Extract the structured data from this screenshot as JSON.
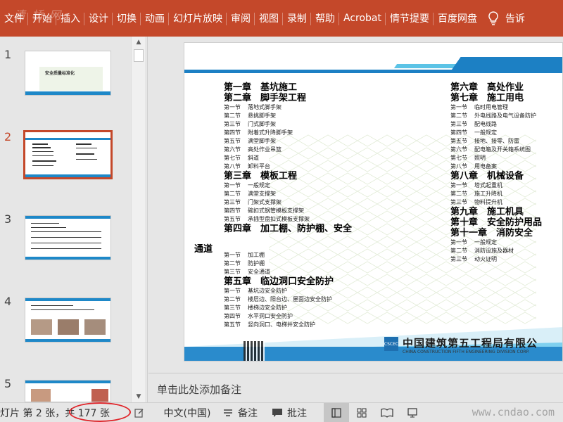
{
  "ribbon": {
    "tabs": [
      "文件",
      "开始",
      "插入",
      "设计",
      "切换",
      "动画",
      "幻灯片放映",
      "审阅",
      "视图",
      "录制",
      "帮助",
      "Acrobat",
      "情节提要",
      "百度网盘"
    ],
    "tell_me": "告诉",
    "watermark": "清 桥 网"
  },
  "thumbnails": [
    {
      "num": "1"
    },
    {
      "num": "2",
      "active": true
    },
    {
      "num": "3"
    },
    {
      "num": "4"
    },
    {
      "num": "5"
    }
  ],
  "thumb1_title": "安全质量标准化",
  "slide": {
    "left_chapters": [
      {
        "title": "第一章　基坑施工",
        "sections": []
      },
      {
        "title": "第二章　脚手架工程",
        "sections": [
          [
            "第一节",
            "落地式脚手架"
          ],
          [
            "第二节",
            "悬挑脚手架"
          ],
          [
            "第三节",
            "门式脚手架"
          ],
          [
            "第四节",
            "附着式升降脚手架"
          ],
          [
            "第五节",
            "满堂脚手架"
          ],
          [
            "第六节",
            "高处作业吊篮"
          ],
          [
            "第七节",
            "斜道"
          ],
          [
            "第八节",
            "卸料平台"
          ]
        ]
      },
      {
        "title": "第三章　模板工程",
        "sections": [
          [
            "第一节",
            "一般规定"
          ],
          [
            "第二节",
            "满堂支撑架"
          ],
          [
            "第三节",
            "门架式支撑架"
          ],
          [
            "第四节",
            "碗扣式钢管模板支撑架"
          ],
          [
            "第五节",
            "承插型盘扣式模板支撑架"
          ]
        ]
      },
      {
        "title": "第四章　加工棚、防护棚、安全",
        "sections": []
      }
    ],
    "tongdao": "通道",
    "left_chapters_2": [
      {
        "title": "",
        "sections": [
          [
            "第一节",
            "加工棚"
          ],
          [
            "第二节",
            "防护棚"
          ],
          [
            "第三节",
            "安全通道"
          ]
        ]
      },
      {
        "title": "第五章　临边洞口安全防护",
        "sections": [
          [
            "第一节",
            "基坑边安全防护"
          ],
          [
            "第二节",
            "楼层边、阳台边、屋面边安全防护"
          ],
          [
            "第三节",
            "楼梯边安全防护"
          ],
          [
            "第四节",
            "水平洞口安全防护"
          ],
          [
            "第五节",
            "竖向洞口、电梯井安全防护"
          ]
        ]
      }
    ],
    "right_chapters": [
      {
        "title": "第六章　高处作业",
        "sections": []
      },
      {
        "title": "第七章　施工用电",
        "sections": [
          [
            "第一节",
            "临时用电管理"
          ],
          [
            "第二节",
            "外电线路及电气设备防护"
          ],
          [
            "第三节",
            "配电线路"
          ],
          [
            "第四节",
            "一般规定"
          ],
          [
            "第五节",
            "接地、接零、防雷"
          ],
          [
            "第六节",
            "配电箱及开关箱系统图"
          ],
          [
            "第七节",
            "照明"
          ],
          [
            "第八节",
            "用电备案"
          ]
        ]
      },
      {
        "title": "第八章　机械设备",
        "sections": [
          [
            "第一节",
            "塔式起重机"
          ],
          [
            "第二节",
            "施工升降机"
          ],
          [
            "第三节",
            "物料提升机"
          ]
        ]
      },
      {
        "title": "第九章　施工机具",
        "sections": []
      },
      {
        "title": "第十章　安全防护用品",
        "sections": []
      },
      {
        "title": "第十一章　消防安全",
        "sections": [
          [
            "第一节",
            "一般规定"
          ],
          [
            "第二节",
            "消防设施及器材"
          ],
          [
            "第三节",
            "动火证明"
          ]
        ]
      }
    ],
    "company": "中国建筑第五工程局有限公",
    "company_en": "CHINA CONSTRUCTION FIFTH ENGINEERING DIVISION CORP.",
    "logo_text": "CSCEC"
  },
  "notes_placeholder": "单击此处添加备注",
  "status": {
    "slide_count": "灯片 第 2 张，共 177 张",
    "language": "中文(中国)",
    "notes": "备注",
    "comments": "批注",
    "watermark": "www.cndao.com"
  },
  "colors": {
    "ribbon": "#c4482a",
    "accent_blue": "#1c80c4",
    "annotation_circle": "#e0262b"
  }
}
